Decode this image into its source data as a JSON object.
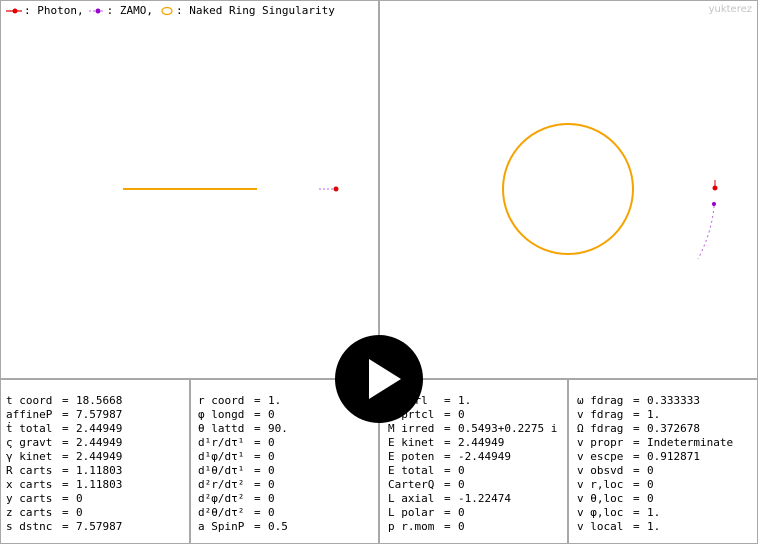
{
  "legend": {
    "photon_label": ": Photon,",
    "zamo_label": ": ZAMO,",
    "ring_label": ": Naked Ring Singularity",
    "photon_color": "#e00000",
    "zamo_color": "#9a00d0",
    "ring_color": "#f5a300"
  },
  "watermark": "yukterez",
  "readouts": [
    [
      {
        "key": "t coord",
        "value": "18.5668"
      },
      {
        "key": "affineP",
        "value": "7.57987"
      },
      {
        "key": "ṫ total",
        "value": "2.44949"
      },
      {
        "key": "ς gravt",
        "value": "2.44949"
      },
      {
        "key": "γ kinet",
        "value": "2.44949"
      },
      {
        "key": "R carts",
        "value": "1.11803"
      },
      {
        "key": "x carts",
        "value": "1.11803"
      },
      {
        "key": "y carts",
        "value": "0"
      },
      {
        "key": "z carts",
        "value": "0"
      },
      {
        "key": "s dstnc",
        "value": "7.57987"
      }
    ],
    [
      {
        "key": "r coord",
        "value": "1."
      },
      {
        "key": "φ longd",
        "value": "0"
      },
      {
        "key": "θ lattd",
        "value": "90."
      },
      {
        "key": "d¹r/dτ¹",
        "value": "0"
      },
      {
        "key": "d¹φ/dτ¹",
        "value": "0"
      },
      {
        "key": "d¹θ/dτ¹",
        "value": "0"
      },
      {
        "key": "d²r/dτ²",
        "value": "0"
      },
      {
        "key": "d²φ/dτ²",
        "value": "0"
      },
      {
        "key": "d²θ/dτ²",
        "value": "0"
      },
      {
        "key": "a SpinP",
        "value": "0.5"
      }
    ],
    [
      {
        "key": "M ctrl",
        "value": "1."
      },
      {
        "key": "M prtcl",
        "value": "0"
      },
      {
        "key": "M irred",
        "value": "0.5493+0.2275 i"
      },
      {
        "key": "E kinet",
        "value": "2.44949"
      },
      {
        "key": "E poten",
        "value": "-2.44949"
      },
      {
        "key": "E total",
        "value": "0"
      },
      {
        "key": "CarterQ",
        "value": "0"
      },
      {
        "key": "L axial",
        "value": "-1.22474"
      },
      {
        "key": "L polar",
        "value": "0"
      },
      {
        "key": "p r.mom",
        "value": "0"
      }
    ],
    [
      {
        "key": "ω fdrag",
        "value": "0.333333"
      },
      {
        "key": "v fdrag",
        "value": "1."
      },
      {
        "key": "Ω fdrag",
        "value": "0.372678"
      },
      {
        "key": "v propr",
        "value": "Indeterminate"
      },
      {
        "key": "v escpe",
        "value": "0.912871"
      },
      {
        "key": "v obsvd",
        "value": "0"
      },
      {
        "key": "v r,loc",
        "value": "0"
      },
      {
        "key": "v θ,loc",
        "value": "0"
      },
      {
        "key": "v φ,loc",
        "value": "1."
      },
      {
        "key": "v local",
        "value": "1."
      }
    ]
  ]
}
